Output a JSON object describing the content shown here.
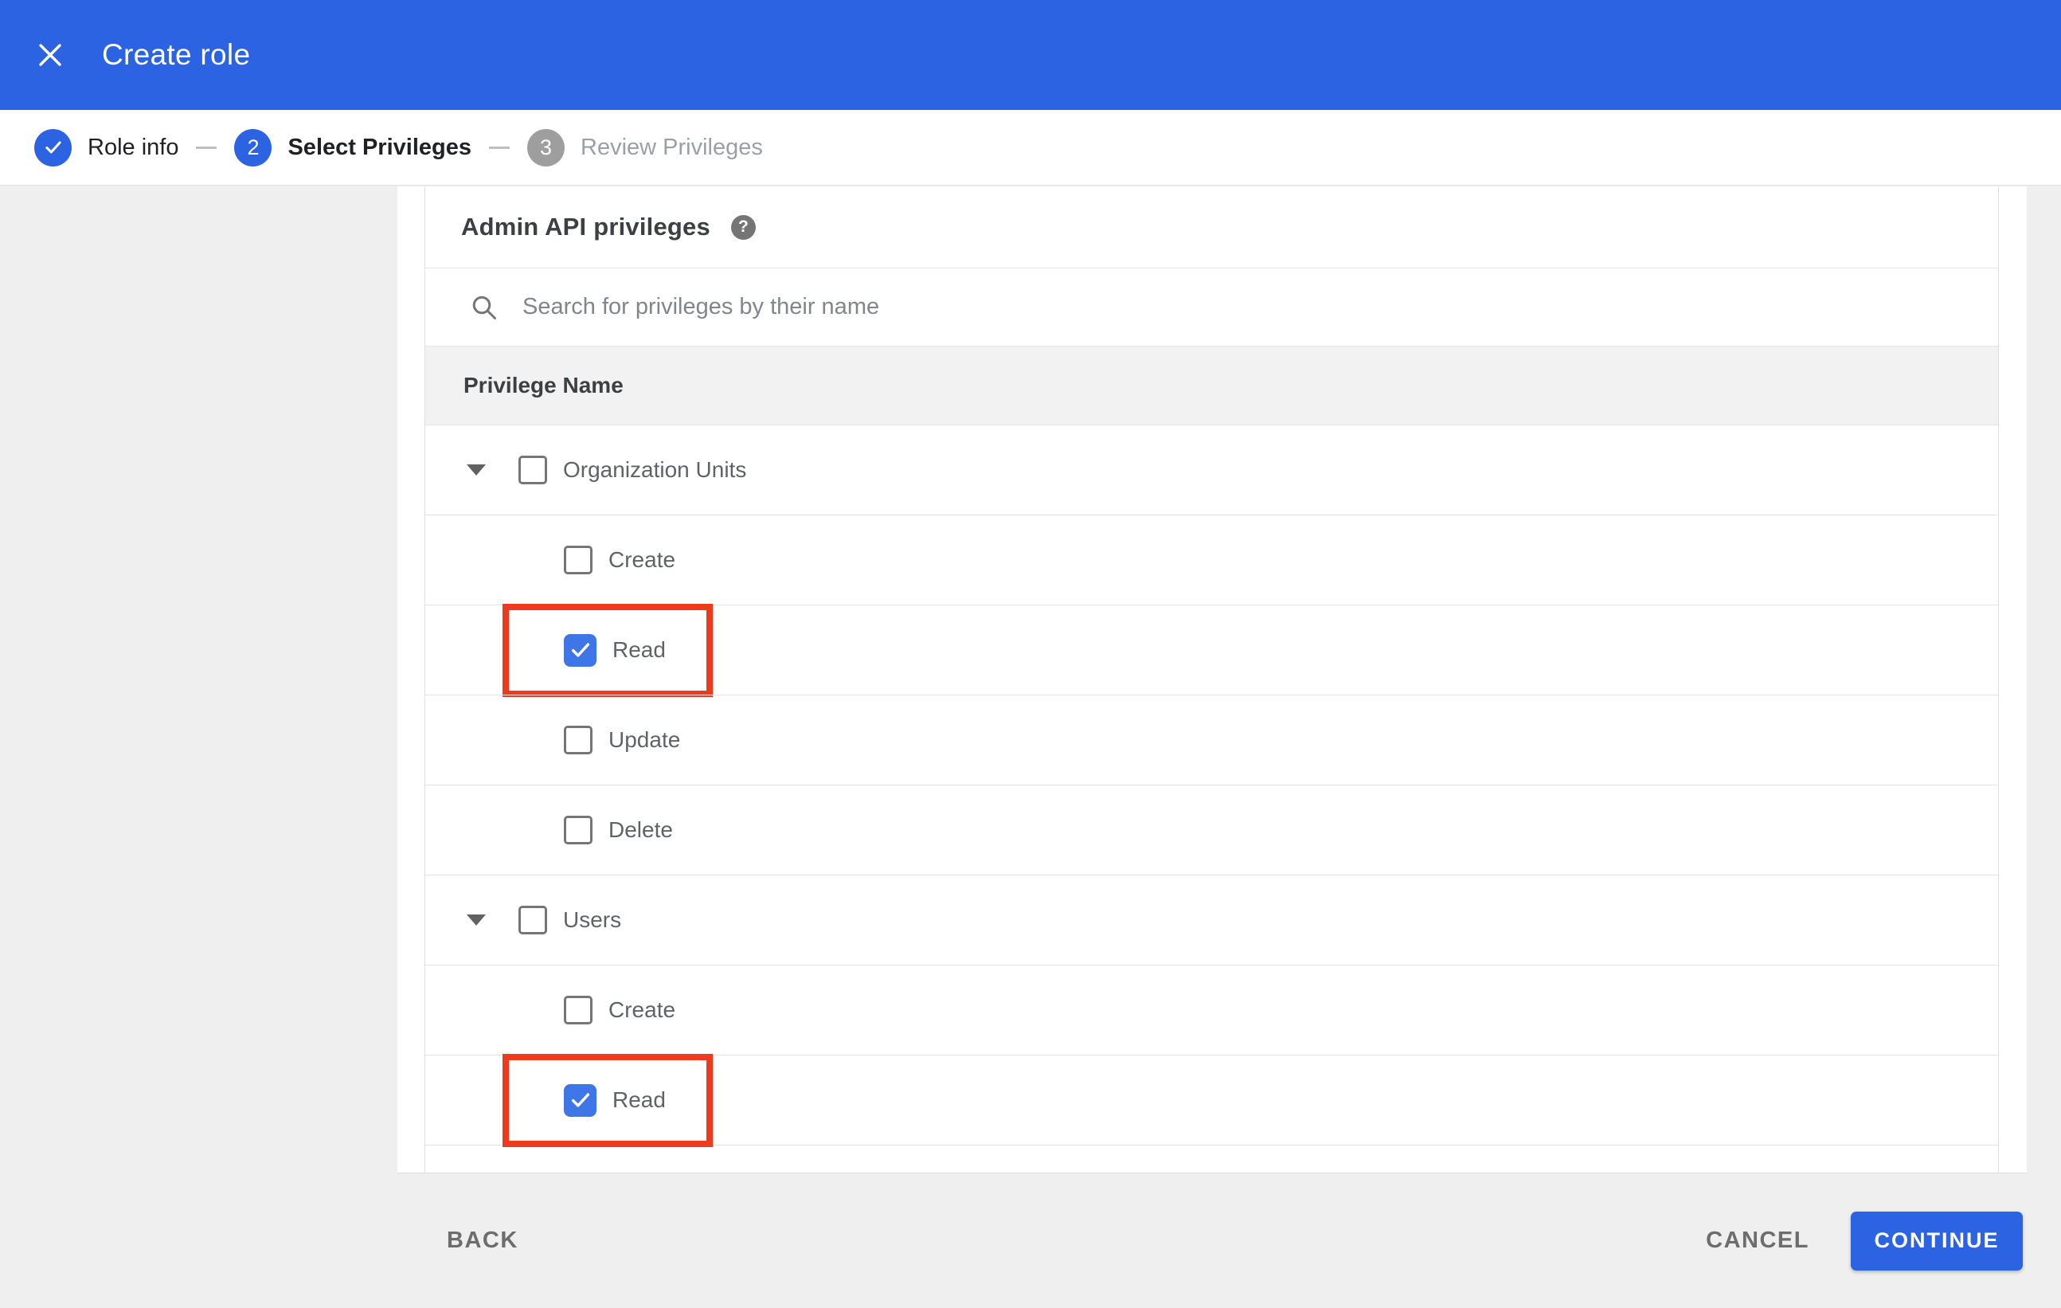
{
  "header": {
    "title": "Create role"
  },
  "stepper": {
    "steps": [
      {
        "number": "",
        "label": "Role info",
        "status": "completed"
      },
      {
        "number": "2",
        "label": "Select Privileges",
        "status": "active"
      },
      {
        "number": "3",
        "label": "Review Privileges",
        "status": "upcoming"
      }
    ]
  },
  "privileges": {
    "heading": "Admin API privileges",
    "help_icon": "?",
    "search_placeholder": "Search for privileges by their name",
    "search_value": "",
    "column_header": "Privilege Name",
    "groups": [
      {
        "label": "Organization Units",
        "checked": false,
        "expanded": true,
        "children": [
          {
            "label": "Create",
            "checked": false,
            "highlighted": false
          },
          {
            "label": "Read",
            "checked": true,
            "highlighted": true
          },
          {
            "label": "Update",
            "checked": false,
            "highlighted": false
          },
          {
            "label": "Delete",
            "checked": false,
            "highlighted": false
          }
        ]
      },
      {
        "label": "Users",
        "checked": false,
        "expanded": true,
        "children": [
          {
            "label": "Create",
            "checked": false,
            "highlighted": false
          },
          {
            "label": "Read",
            "checked": true,
            "highlighted": true
          }
        ]
      }
    ]
  },
  "footer": {
    "back": "BACK",
    "cancel": "CANCEL",
    "continue": "CONTINUE"
  },
  "colors": {
    "primary_blue": "#2b63e3",
    "checkbox_blue": "#3e76e8",
    "highlight_red": "#ef3b1d",
    "inactive_gray": "#9e9e9e"
  }
}
